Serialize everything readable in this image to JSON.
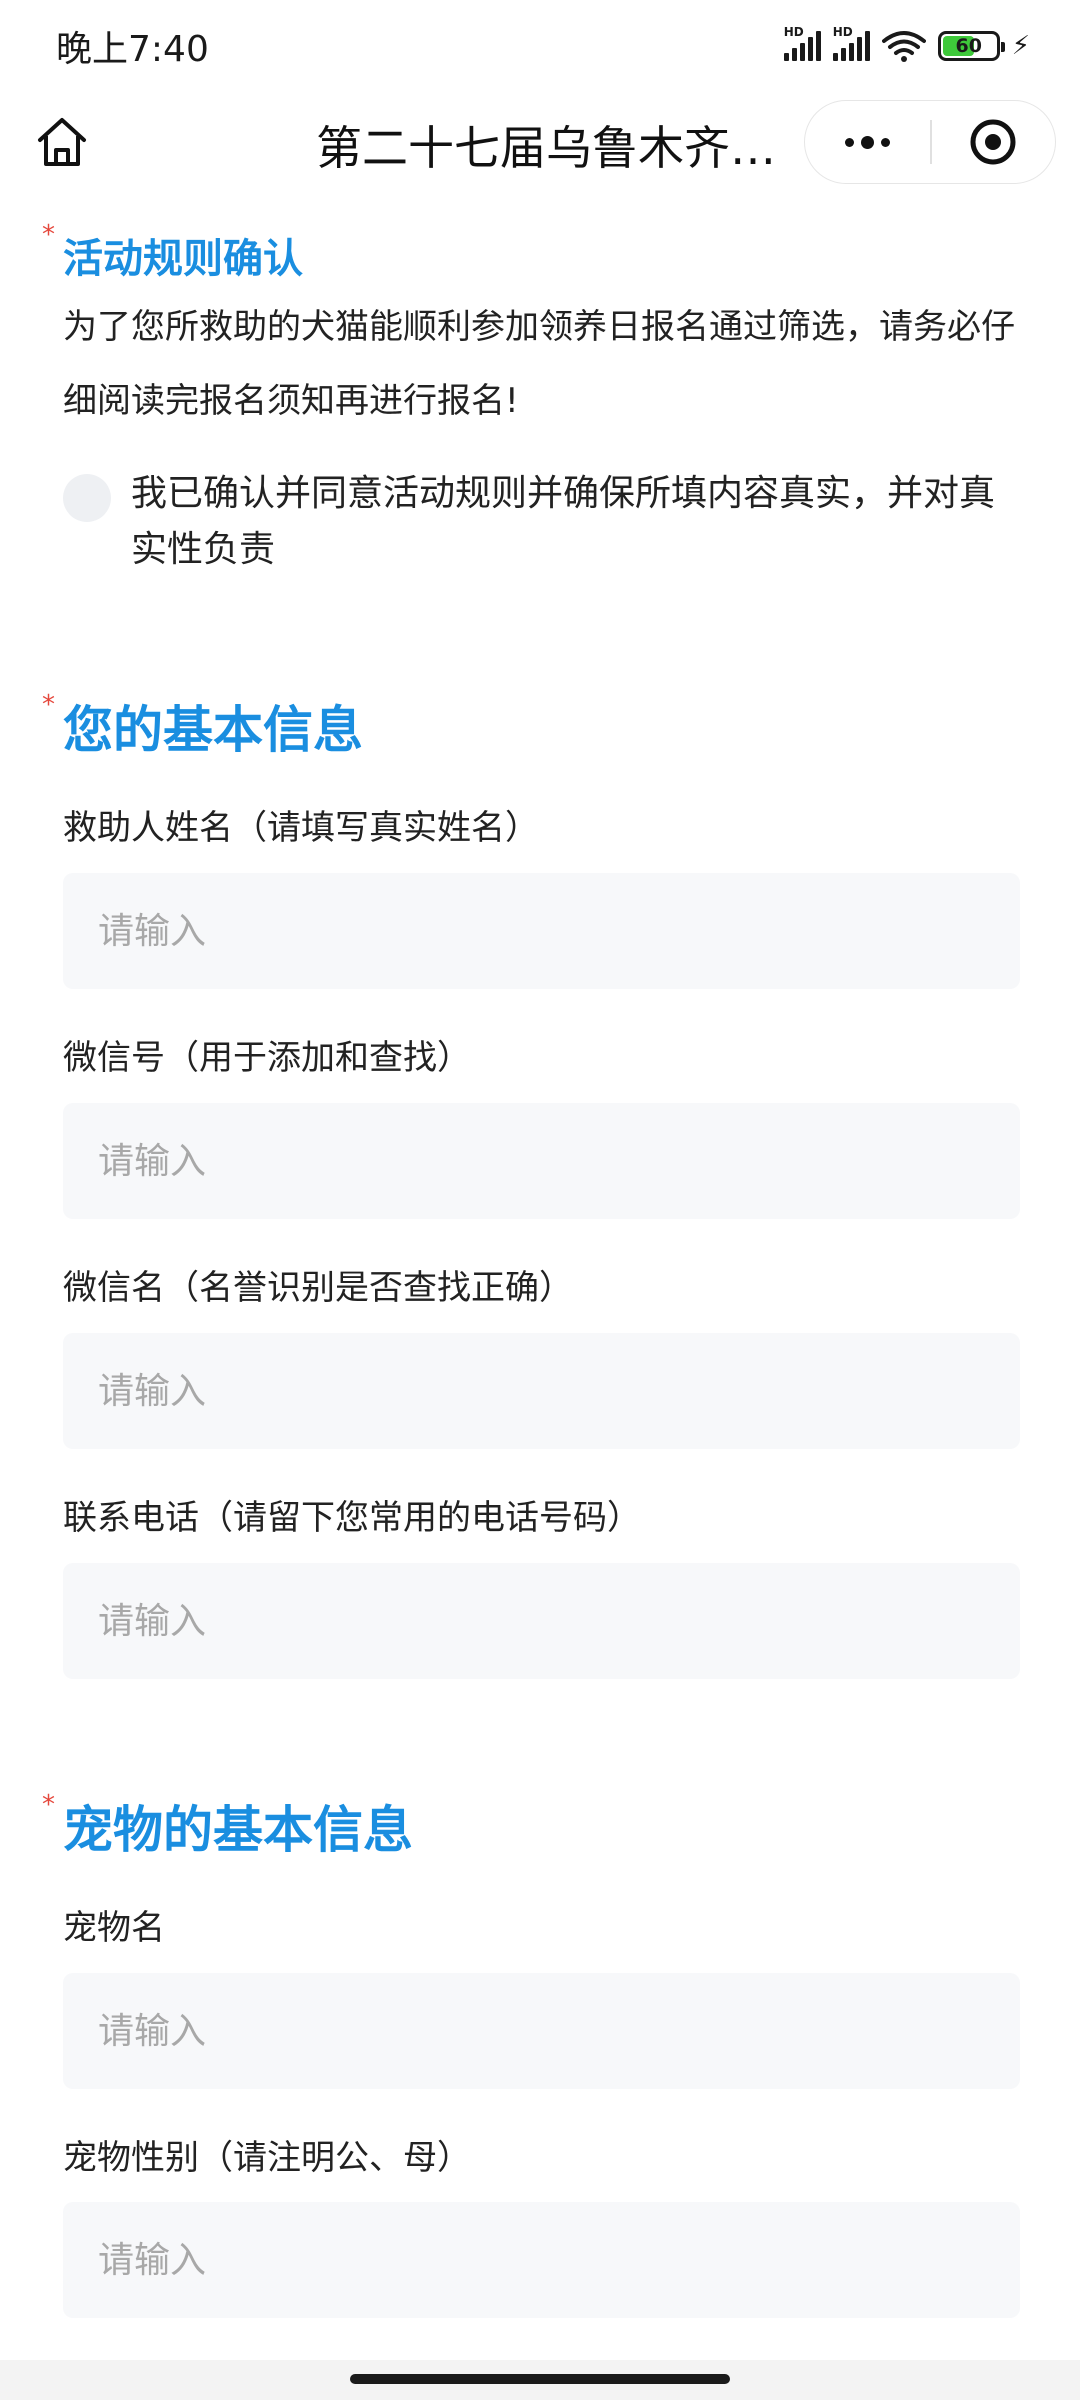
{
  "status_bar": {
    "time": "晚上7:40",
    "signal_label_1": "HD",
    "signal_label_2": "HD",
    "battery_level": "60",
    "charging_icon": "bolt-icon"
  },
  "nav": {
    "title": "第二十七届乌鲁木齐…",
    "home_icon": "home-icon",
    "more_icon": "more-dots-icon",
    "close_icon": "target-close-icon"
  },
  "rules": {
    "title": "活动规则确认",
    "description": "为了您所救助的犬猫能顺利参加领养日报名通过筛选，请务必仔细阅读完报名须知再进行报名!",
    "agree_text": "我已确认并同意活动规则并确保所填内容真实，并对真实性负责",
    "required_mark": "*"
  },
  "basic_info": {
    "title": "您的基本信息",
    "required_mark": "*",
    "fields": [
      {
        "label": "救助人姓名（请填写真实姓名）",
        "placeholder": "请输入",
        "value": ""
      },
      {
        "label": "微信号（用于添加和查找）",
        "placeholder": "请输入",
        "value": ""
      },
      {
        "label": "微信名（名誉识别是否查找正确）",
        "placeholder": "请输入",
        "value": ""
      },
      {
        "label": "联系电话（请留下您常用的电话号码）",
        "placeholder": "请输入",
        "value": ""
      }
    ]
  },
  "pet_info": {
    "title": "宠物的基本信息",
    "required_mark": "*",
    "fields": [
      {
        "label": "宠物名",
        "placeholder": "请输入",
        "value": ""
      },
      {
        "label": "宠物性别（请注明公、母）",
        "placeholder": "请输入",
        "value": ""
      }
    ]
  },
  "colors": {
    "accent": "#1a8ee0",
    "required": "#e5483d",
    "input_bg": "#f7f8fa",
    "placeholder": "#a8a8a8"
  }
}
